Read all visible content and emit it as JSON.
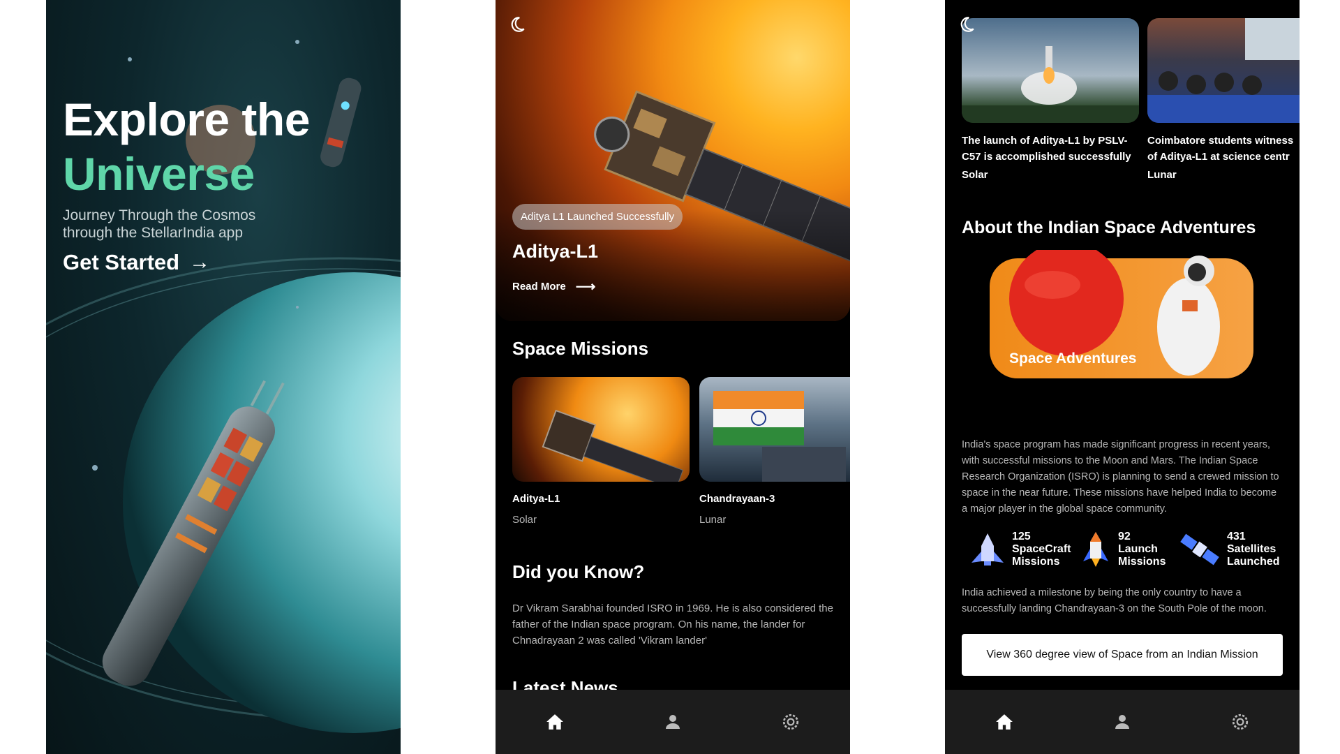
{
  "screen1": {
    "title_line1": "Explore the",
    "title_line2": "Universe",
    "subtitle": "Journey Through the Cosmos through the StellarIndia app",
    "cta_label": "Get Started",
    "cta_arrow": "→"
  },
  "screen2": {
    "theme_icon": "moon-icon",
    "hero": {
      "badge": "Aditya L1 Launched Successfully",
      "title": "Aditya-L1",
      "read_more": "Read More",
      "arrow": "⟶"
    },
    "missions_heading": "Space Missions",
    "missions": [
      {
        "title": "Aditya-L1",
        "tag": "Solar"
      },
      {
        "title": "Chandrayaan-3",
        "tag": "Lunar"
      }
    ],
    "dyk_heading": "Did you Know?",
    "dyk_text": "Dr Vikram Sarabhai founded ISRO in 1969. He is also considered the father of the Indian space program. On his name, the lander for Chnadrayaan 2 was called 'Vikram lander'",
    "latest_heading": "Latest News"
  },
  "screen3": {
    "news": [
      {
        "title_line1": "The launch of Aditya-L1 by PSLV-",
        "title_line2": "C57 is accomplished successfully",
        "tag": "Solar"
      },
      {
        "title_line1": "Coimbatore students witness",
        "title_line2": "of Aditya-L1 at science centr",
        "tag": "Lunar"
      }
    ],
    "about_heading": "About the Indian Space Adventures",
    "banner_label": "Space Adventures",
    "about_text": "India's space program has made significant progress in recent years, with successful missions to the Moon and Mars. The Indian Space Research Organization (ISRO) is planning to send a crewed mission to space in the near future. These missions have helped India to become a major player in the global space community.",
    "stats": [
      {
        "num": "125",
        "line1": "SpaceCraft",
        "line2": "Missions",
        "icon": "spacecraft-icon"
      },
      {
        "num": "92",
        "line1": "Launch",
        "line2": "Missions",
        "icon": "rocket-icon"
      },
      {
        "num": "431",
        "line1": "Satellites",
        "line2": "Launched",
        "icon": "satellite-icon"
      }
    ],
    "milestone_text": "India achieved a milestone by being the only country to have a successfully landing Chandrayaan-3 on the South Pole of the moon.",
    "cta_label": "View 360 degree view of Space from an Indian Mission"
  },
  "navbar": {
    "items": [
      "home-icon",
      "profile-icon",
      "settings-icon"
    ]
  },
  "colors": {
    "accent_green": "#5fd6a9",
    "orange": "#f08a18",
    "nav_bg": "#1c1c1c"
  }
}
